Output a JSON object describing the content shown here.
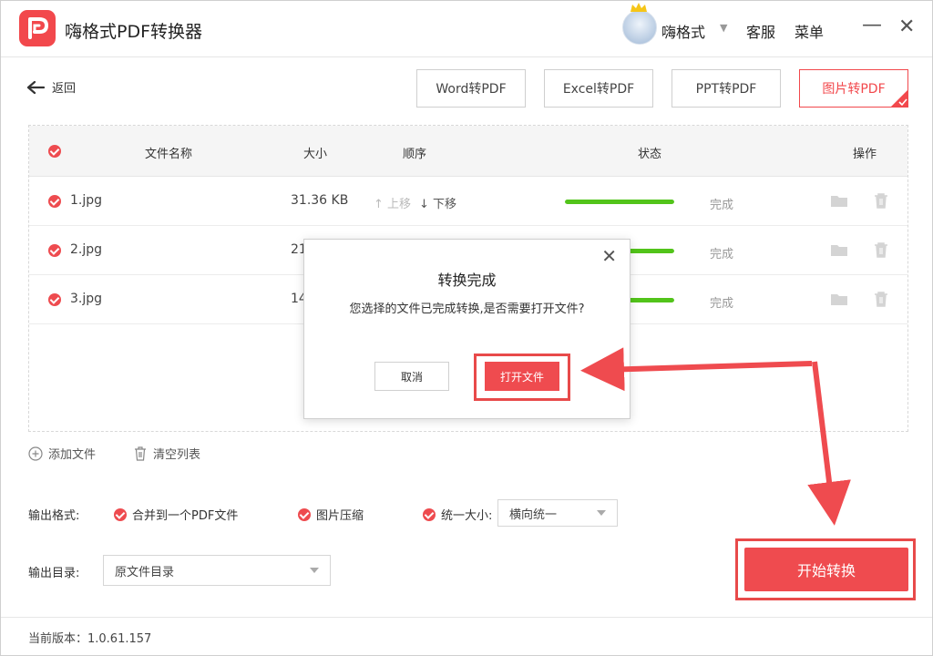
{
  "app": {
    "title": "嗨格式PDF转换器"
  },
  "header": {
    "user_name": "嗨格式",
    "service": "客服",
    "menu": "菜单",
    "minimize": "—",
    "close": "✕"
  },
  "back_label": "返回",
  "tabs": [
    {
      "label": "Word转PDF",
      "active": false
    },
    {
      "label": "Excel转PDF",
      "active": false
    },
    {
      "label": "PPT转PDF",
      "active": false
    },
    {
      "label": "图片转PDF",
      "active": true
    }
  ],
  "table": {
    "headers": {
      "name": "文件名称",
      "size": "大小",
      "order": "顺序",
      "status": "状态",
      "action": "操作"
    },
    "rows": [
      {
        "name": "1.jpg",
        "size": "31.36 KB",
        "move_up": "↑ 上移",
        "move_down": "↓ 下移",
        "progress": 100,
        "status": "完成"
      },
      {
        "name": "2.jpg",
        "size": "21",
        "progress": 100,
        "status": "完成"
      },
      {
        "name": "3.jpg",
        "size": "14",
        "progress": 100,
        "status": "完成"
      }
    ]
  },
  "actions": {
    "add_file": "添加文件",
    "clear_list": "清空列表"
  },
  "output": {
    "format_label": "输出格式:",
    "merge": "合并到一个PDF文件",
    "compress": "图片压缩",
    "unify_size": "统一大小:",
    "unify_value": "横向统一",
    "dir_label": "输出目录:",
    "dir_value": "原文件目录"
  },
  "start_button": "开始转换",
  "footer": {
    "version": "当前版本：1.0.61.157"
  },
  "modal": {
    "title": "转换完成",
    "message": "您选择的文件已完成转换,是否需要打开文件?",
    "cancel": "取消",
    "open": "打开文件"
  },
  "colors": {
    "accent": "#ef4b4f",
    "progress": "#52c41a",
    "annotation": "#e84a4a"
  }
}
